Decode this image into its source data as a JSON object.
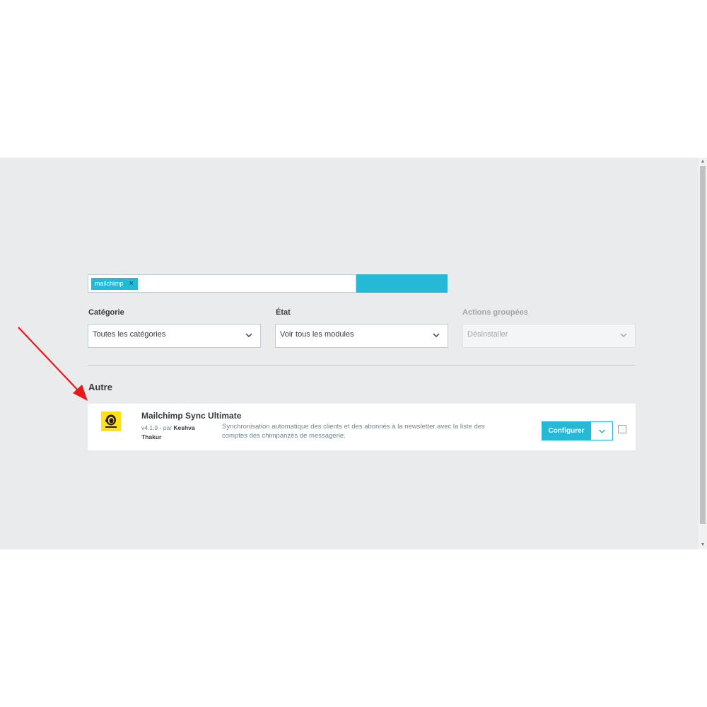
{
  "search": {
    "tag_label": "mailchimp",
    "tag_remove_icon": "×"
  },
  "filters": {
    "category": {
      "label": "Catégorie",
      "selected": "Toutes les catégories"
    },
    "state": {
      "label": "État",
      "selected": "Voir tous les modules"
    },
    "bulk_actions": {
      "label": "Actions groupées",
      "selected": "Désinstaller"
    }
  },
  "section": {
    "title": "Autre"
  },
  "module": {
    "name": "Mailchimp Sync Ultimate",
    "version_prefix": "v4.1.9 - par ",
    "author": "Keshva Thakur",
    "description": "Synchronisation automatique des clients et des abonnés à la newsletter avec la liste des comptes des chimpanzés de messagerie.",
    "configure_label": "Configurer",
    "logo_icon": "mailchimp-logo-icon"
  },
  "colors": {
    "primary": "#25b9d7",
    "panel_bg": "#eaebec",
    "text": "#363a41",
    "muted_text": "#6c868e",
    "annotation_arrow": "#e8191a",
    "logo_bg": "#ffe01b"
  }
}
